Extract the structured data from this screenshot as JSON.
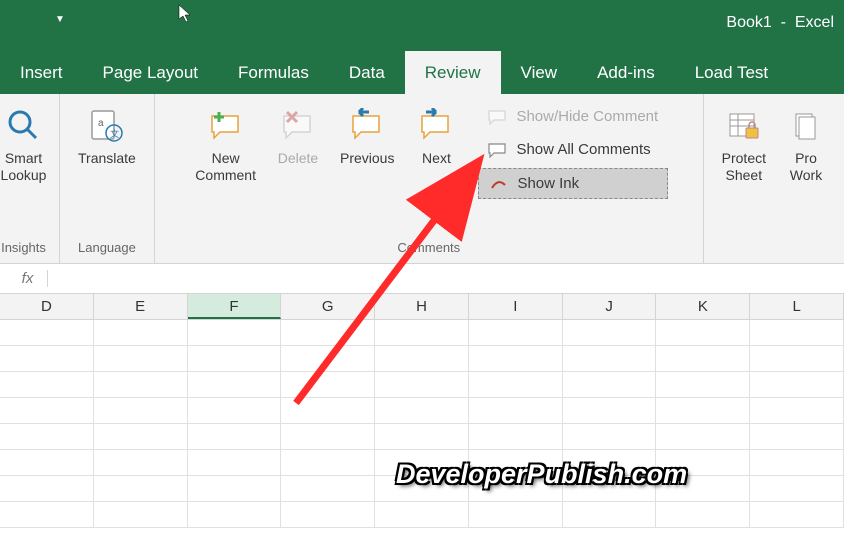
{
  "title": {
    "doc": "Book1",
    "sep": "-",
    "app": "Excel"
  },
  "tabs": {
    "insert": "Insert",
    "page_layout": "Page Layout",
    "formulas": "Formulas",
    "data": "Data",
    "review": "Review",
    "view": "View",
    "add_ins": "Add-ins",
    "load_test": "Load Test"
  },
  "ribbon": {
    "smart_lookup": "Smart\nLookup",
    "translate": "Translate",
    "new_comment": "New\nComment",
    "delete": "Delete",
    "previous": "Previous",
    "next": "Next",
    "show_hide": "Show/Hide Comment",
    "show_all": "Show All Comments",
    "show_ink": "Show Ink",
    "protect_sheet": "Protect\nSheet",
    "protect_workbook": "Pro\nWork",
    "group_insights": "Insights",
    "group_language": "Language",
    "group_comments": "Comments"
  },
  "columns": [
    "D",
    "E",
    "F",
    "G",
    "H",
    "I",
    "J",
    "K",
    "L"
  ],
  "selected_col": "F",
  "fx": "fx",
  "watermark": "DeveloperPublish.com"
}
